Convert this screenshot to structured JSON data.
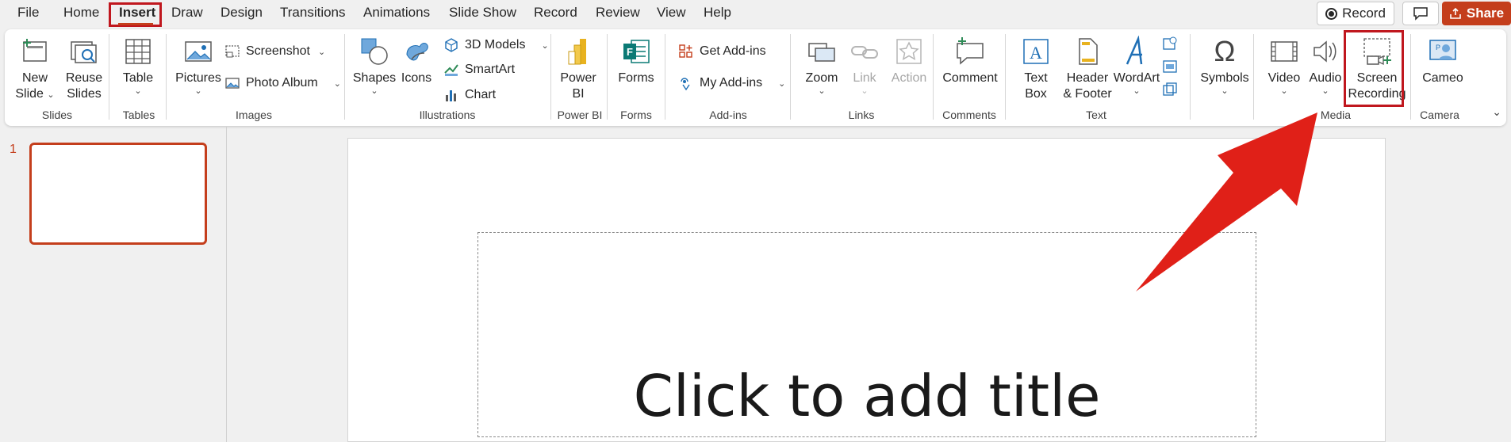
{
  "menu": {
    "items": [
      "File",
      "Home",
      "Insert",
      "Draw",
      "Design",
      "Transitions",
      "Animations",
      "Slide Show",
      "Record",
      "Review",
      "View",
      "Help"
    ],
    "active": "Insert"
  },
  "top_right": {
    "record_label": "Record",
    "share_label": "Share"
  },
  "ribbon": {
    "slides": {
      "new_slide": "New",
      "new_slide_2": "Slide",
      "reuse": "Reuse",
      "reuse_2": "Slides",
      "label": "Slides"
    },
    "tables": {
      "table": "Table",
      "label": "Tables"
    },
    "images": {
      "pictures": "Pictures",
      "screenshot": "Screenshot",
      "photo_album": "Photo Album",
      "label": "Images"
    },
    "illustrations": {
      "shapes": "Shapes",
      "icons": "Icons",
      "models_3d": "3D Models",
      "smartart": "SmartArt",
      "chart": "Chart",
      "label": "Illustrations"
    },
    "power_bi": {
      "power": "Power",
      "bi": "BI",
      "label": "Power BI"
    },
    "forms": {
      "forms": "Forms",
      "label": "Forms"
    },
    "addins": {
      "get": "Get Add-ins",
      "my": "My Add-ins",
      "label": "Add-ins"
    },
    "links": {
      "zoom": "Zoom",
      "link": "Link",
      "action": "Action",
      "label": "Links"
    },
    "comments": {
      "comment": "Comment",
      "label": "Comments"
    },
    "text": {
      "text_box": "Text",
      "text_box_2": "Box",
      "header": "Header",
      "header_2": "& Footer",
      "wordart": "WordArt",
      "label": "Text"
    },
    "symbols": {
      "symbols": "Symbols"
    },
    "media": {
      "video": "Video",
      "audio": "Audio",
      "screen": "Screen",
      "recording": "Recording",
      "label": "Media"
    },
    "camera": {
      "cameo": "Cameo",
      "label": "Camera"
    }
  },
  "thumbnails": {
    "slide_number": "1"
  },
  "slide": {
    "title_placeholder": "Click to add title"
  },
  "colors": {
    "accent": "#c43e1c",
    "highlight_box": "#c0171e",
    "arrow": "#e02018"
  }
}
